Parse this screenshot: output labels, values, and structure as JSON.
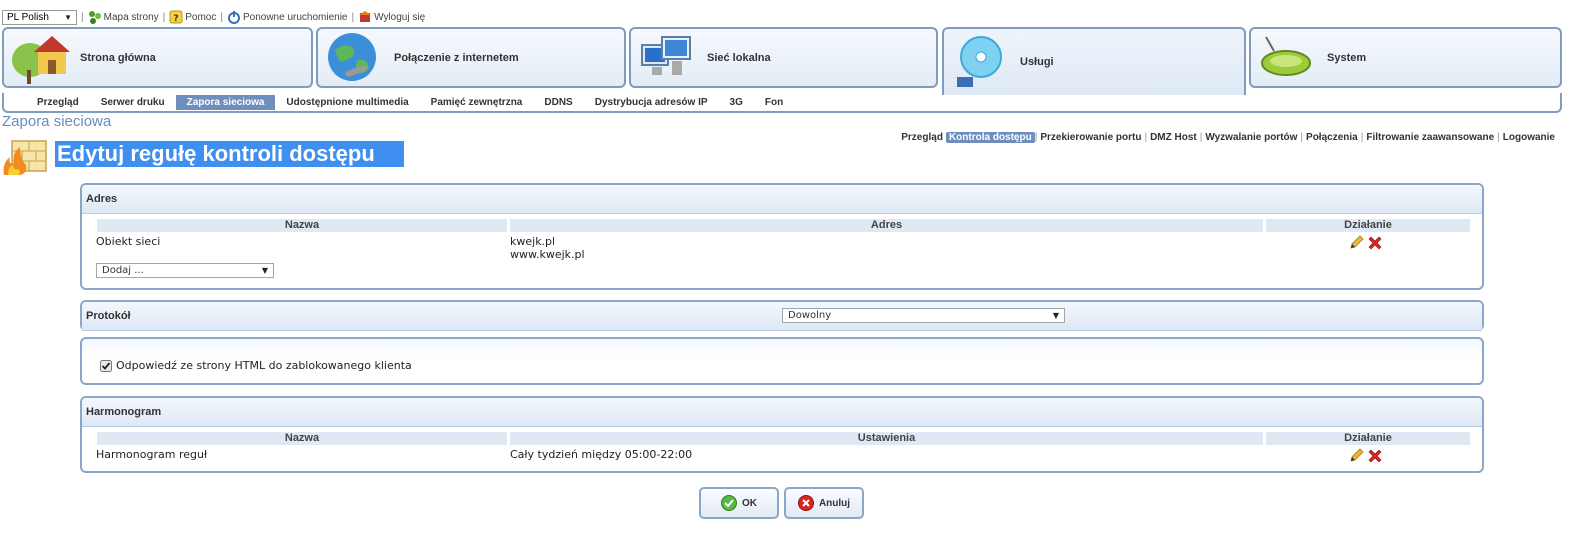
{
  "topbar": {
    "language": "PL Polish",
    "links": {
      "sitemap": "Mapa strony",
      "help": "Pomoc",
      "restart": "Ponowne uruchomienie",
      "logout": "Wyloguj się"
    }
  },
  "main_tabs": [
    {
      "label": "Strona główna",
      "icon": "house-icon"
    },
    {
      "label": "Połączenie z internetem",
      "icon": "globe-icon"
    },
    {
      "label": "Sieć lokalna",
      "icon": "computers-icon"
    },
    {
      "label": "Usługi",
      "icon": "cd-icon",
      "active": true
    },
    {
      "label": "System",
      "icon": "router-icon"
    }
  ],
  "sub_nav": {
    "items": [
      "Przegląd",
      "Serwer druku",
      "Zapora sieciowa",
      "Udostępnione multimedia",
      "Pamięć zewnętrzna",
      "DDNS",
      "Dystrybucja adresów IP",
      "3G",
      "Fon"
    ],
    "active": "Zapora sieciowa"
  },
  "section_title": "Zapora sieciowa",
  "right_links": {
    "items": [
      "Przegląd",
      "Kontrola dostępu",
      "Przekierowanie portu",
      "DMZ Host",
      "Wyzwalanie portów",
      "Połączenia",
      "Filtrowanie zaawansowane",
      "Logowanie"
    ],
    "active": "Kontrola dostępu"
  },
  "page_title": "Edytuj regułę kontroli dostępu",
  "address_panel": {
    "title": "Adres",
    "columns": {
      "name": "Nazwa",
      "address": "Adres",
      "action": "Działanie"
    },
    "row": {
      "name": "Obiekt sieci",
      "address_1": "kwejk.pl",
      "address_2": "www.kwejk.pl"
    },
    "add_select": "Dodaj ..."
  },
  "protocol_panel": {
    "title": "Protokół",
    "value": "Dowolny"
  },
  "response_panel": {
    "checkbox_label": "Odpowiedź ze strony HTML do zablokowanego klienta",
    "checked": true
  },
  "schedule_panel": {
    "title": "Harmonogram",
    "columns": {
      "name": "Nazwa",
      "settings": "Ustawienia",
      "action": "Działanie"
    },
    "row": {
      "name": "Harmonogram reguł",
      "settings": "Cały tydzień między 05:00-22:00"
    }
  },
  "buttons": {
    "ok": "OK",
    "cancel": "Anuluj"
  },
  "colors": {
    "accent": "#3f8ff0",
    "nav_active": "#6e8ebd",
    "border": "#8aa6c9"
  }
}
